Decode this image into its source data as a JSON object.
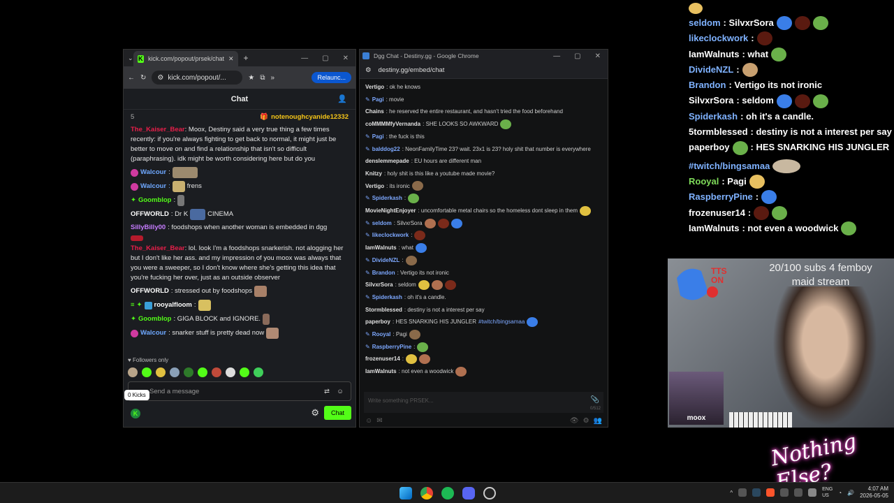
{
  "kick_window": {
    "tab_title": "kick.com/popout/prsek/chat",
    "url": "kick.com/popout/...",
    "relaunch_label": "Relaunc...",
    "header_title": "Chat",
    "pinned_index": "5",
    "pinned_user": "notenoughcyanide12332",
    "messages": [
      {
        "user": "The_Kaiser_Bear",
        "user_color": "#e91e4a",
        "text": ": Moox, Destiny said a very true thing a few times recently: if you're always fighting to get back to normal, it might just be better to move on and find a relationship that isn't so difficult (paraphrasing). idk might be worth considering here but do you"
      },
      {
        "user": "Walcour",
        "user_color": "#6ea8ff",
        "text": ":"
      },
      {
        "user": "Walcour",
        "user_color": "#6ea8ff",
        "text": "frens"
      },
      {
        "user": "Goomblop",
        "user_color": "#53fc18",
        "text": ":"
      },
      {
        "user": "OFFWORLD",
        "user_color": "#ffffff",
        "text": ": Dr K",
        "extra": "CINEMA"
      },
      {
        "user": "SillyBilly00",
        "user_color": "#c77dff",
        "text": ": foodshops when another woman is embedded in dgg"
      },
      {
        "user": "The_Kaiser_Bear",
        "user_color": "#e91e4a",
        "text": ": lol. look I'm a foodshops snarkerish. not alogging her but I don't like her ass. and my impression of you moox was always that you were a sweeper, so I don't know where she's getting this idea that you're fucking her over, just as an outside observer"
      },
      {
        "user": "OFFWORLD",
        "user_color": "#ffffff",
        "text": ": stressed out by foodshops"
      },
      {
        "user": "rooyalfloom",
        "user_color": "#ffffff",
        "text": ":"
      },
      {
        "user": "Goomblop",
        "user_color": "#53fc18",
        "text": ": GIGA BLOCK and IGNORE."
      },
      {
        "user": "Walcour",
        "user_color": "#6ea8ff",
        "text": ": snarker stuff is pretty dead now"
      }
    ],
    "followers_only": "Followers only",
    "send_placeholder": "Send a message",
    "kicks_tooltip": "0 Kicks",
    "chat_button": "Chat"
  },
  "dgg_window": {
    "window_title": "Dgg Chat - Destiny.gg - Google Chrome",
    "url": "destiny.gg/embed/chat",
    "messages": [
      {
        "user": "Vertigo",
        "text": ": ok he knows"
      },
      {
        "user": "Pagi",
        "text": ": movie",
        "blue": true
      },
      {
        "user": "Chains",
        "text": ": he reserved the entire restaurant, and hasn't tried the food beforehand"
      },
      {
        "user": "coMMMMfyVernanda",
        "text": ": SHE LOOKS SO AWKWARD"
      },
      {
        "user": "Pagi",
        "text": ": the fuck is this",
        "blue": true
      },
      {
        "user": "balddog22",
        "text": ": NeonFamilyTime 23? wait. 23x1 is 23? holy shit that number is everywhere",
        "blue": true
      },
      {
        "user": "denslemmepade",
        "text": ": EU hours are different man"
      },
      {
        "user": "Knitzy",
        "text": ": holy shit is this like a youtube made movie?"
      },
      {
        "user": "Vertigo",
        "text": ": its ironic"
      },
      {
        "user": "Spiderkash",
        "text": ":",
        "blue": true
      },
      {
        "user": "MovieNightEnjoyer",
        "text": ": uncomfortable metal chairs so the homeless dont sleep in them"
      },
      {
        "user": "seldom",
        "text": ": SilvxrSora",
        "blue": true
      },
      {
        "user": "likeclockwork",
        "text": ":",
        "blue": true
      },
      {
        "user": "IamWalnuts",
        "text": ": what"
      },
      {
        "user": "DivideNZL",
        "text": ":",
        "blue": true
      },
      {
        "user": "Brandon",
        "text": ": Vertigo its not ironic",
        "blue": true
      },
      {
        "user": "SilvxrSora",
        "text": ": seldom"
      },
      {
        "user": "Spiderkash",
        "text": ": oh it's a candle.",
        "blue": true
      },
      {
        "user": "Stormblessed",
        "text": ": destiny is not a interest per say"
      },
      {
        "user": "paperboy",
        "text": ": HES SNARKING HIS JUNGLER",
        "link": "#twitch/bingsamaa"
      },
      {
        "user": "Rooyal",
        "text": ": Pagi",
        "blue": true
      },
      {
        "user": "RaspberryPine",
        "text": ":",
        "blue": true
      },
      {
        "user": "frozenuser14",
        "text": ":"
      },
      {
        "user": "IamWalnuts",
        "text": ": not even a woodwick"
      }
    ],
    "input_placeholder": "Write something PRSEK...",
    "counter": "0/512"
  },
  "overlay_chat": [
    {
      "user": "seldom",
      "text": ": SilvxrSora",
      "color": "#7fb2ff",
      "emotes": 3
    },
    {
      "user": "likeclockwork",
      "text": ":",
      "color": "#7fb2ff",
      "emotes": 1
    },
    {
      "user": "IamWalnuts",
      "text": ": what",
      "color": "#ffffff",
      "emotes": 1
    },
    {
      "user": "DivideNZL",
      "text": ":",
      "color": "#7fb2ff",
      "emotes": 1
    },
    {
      "user": "Brandon",
      "text": ": Vertigo its not ironic",
      "color": "#7fb2ff",
      "emotes": 0
    },
    {
      "user": "SilvxrSora",
      "text": ": seldom",
      "color": "#ffffff",
      "emotes": 3
    },
    {
      "user": "Spiderkash",
      "text": ": oh it's a candle.",
      "color": "#7fb2ff",
      "emotes": 0
    },
    {
      "user": "5tormblessed",
      "text": ": destiny is not a interest per say",
      "color": "#ffffff",
      "emotes": 0
    },
    {
      "user": "paperboy",
      "text": ": HES SNARKING HIS JUNGLER",
      "color": "#ffffff",
      "emotes": 0,
      "link": "#twitch/bingsamaa"
    },
    {
      "user": "Rooyal",
      "text": ": Pagi",
      "color": "#7fdc5a",
      "emotes": 1
    },
    {
      "user": "RaspberryPine",
      "text": ":",
      "color": "#7fb2ff",
      "emotes": 1
    },
    {
      "user": "frozenuser14",
      "text": ":",
      "color": "#ffffff",
      "emotes": 2
    },
    {
      "user": "IamWalnuts",
      "text": ": not even a woodwick",
      "color": "#ffffff",
      "emotes": 1
    }
  ],
  "webcam": {
    "tts_label": "TTS ON",
    "subs_goal": "20/100 subs 4 femboy maid stream",
    "guest_name": "moox"
  },
  "logo_text": "Nothing Else?",
  "taskbar": {
    "lang": "ENG",
    "region": "US",
    "time": "4:07 AM",
    "date": "2026-05-05"
  },
  "colors": {
    "kick_green": "#53fc18",
    "chrome_blue": "#0b57d0"
  }
}
